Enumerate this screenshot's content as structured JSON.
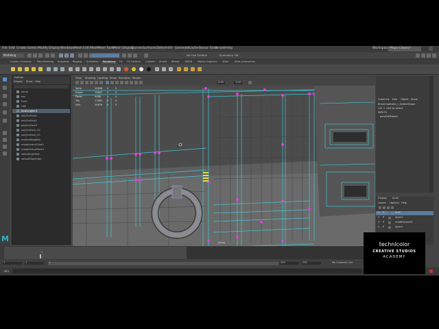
{
  "menubar": {
    "items": [
      "File",
      "Edit",
      "Create",
      "Select",
      "Modify",
      "Display",
      "Windows",
      "Mesh",
      "Edit Mesh",
      "Mesh Tools",
      "Mesh Display",
      "Curves",
      "Surfaces",
      "Deform",
      "UV",
      "Generate",
      "Cache",
      "Bonus Tools",
      "Arnold",
      "Help"
    ],
    "workspace_label": "Workspace:",
    "workspace_value": "Maya Classic*"
  },
  "statusline": {
    "mode_value": "Modeling",
    "no_live_surface": "No Live Surface",
    "symmetry": "Symmetry: Off"
  },
  "shelf": {
    "tabs": [
      "Curves / Surfaces",
      "Poly Modeling",
      "Sculpting",
      "Rigging",
      "Animation",
      "Rendering",
      "FX",
      "FX Caching",
      "Custom",
      "Arnold",
      "Bifrost",
      "MASH",
      "Motion Graphics",
      "XGen",
      "XGen_Interactive"
    ]
  },
  "outliner": {
    "title": "Outliner",
    "menu": [
      "Display",
      "Show",
      "Help"
    ],
    "items": [
      {
        "label": "persp",
        "selected": false
      },
      {
        "label": "top",
        "selected": false
      },
      {
        "label": "front",
        "selected": false
      },
      {
        "label": "side",
        "selected": false
      },
      {
        "label": "Bowlonglam1",
        "selected": true
      },
      {
        "label": "polySurface1",
        "selected": false
      },
      {
        "label": "polySurface2",
        "selected": false
      },
      {
        "label": "polySurface3",
        "selected": false
      },
      {
        "label": "polySurface_CG",
        "selected": false
      },
      {
        "label": "polySurface_CO",
        "selected": false
      },
      {
        "label": "ecoBuildingWall",
        "selected": false
      },
      {
        "label": "ecosphere:pCube1",
        "selected": false
      },
      {
        "label": "ecosphere:pPlane1",
        "selected": false
      },
      {
        "label": "defaultLightSet",
        "selected": false
      },
      {
        "label": "defaultObjectSet",
        "selected": false
      }
    ]
  },
  "viewport": {
    "menu": [
      "View",
      "Shading",
      "Lighting",
      "Show",
      "Renderer",
      "Panels"
    ],
    "hud_rows": [
      {
        "label": "Verts",
        "a": "10898",
        "b": "0",
        "c": "0"
      },
      {
        "label": "Edges",
        "a": "19847",
        "b": "0",
        "c": "0"
      },
      {
        "label": "Faces",
        "a": "9088",
        "b": "0",
        "c": "0"
      },
      {
        "label": "Tris",
        "a": "17892",
        "b": "0",
        "c": "0"
      },
      {
        "label": "UVs",
        "a": "10879",
        "b": "0",
        "c": "0"
      }
    ],
    "field_a": "0.00",
    "field_b": "1.00",
    "camera_label": "persp"
  },
  "channelbox": {
    "menu": [
      "Channels",
      "Edit",
      "Object",
      "Show"
    ],
    "lines": [
      "BrushCapitalio_c_GoblinShape",
      "Ctrl + click to select",
      "INPUTS",
      "polySoftEdge1"
    ]
  },
  "layers": {
    "tabs": [
      "Display",
      "Anim"
    ],
    "menu": [
      "Layers",
      "Options",
      "Help"
    ],
    "items": [
      {
        "label": "bust",
        "selected": true
      },
      {
        "label": "layer2",
        "selected": false
      },
      {
        "label": "modelsLayer2",
        "selected": false
      },
      {
        "label": "layer1",
        "selected": false
      }
    ]
  },
  "timeslider": {
    "start": "1",
    "end": "1",
    "range_start": "1",
    "range_inner": "1",
    "current": "1",
    "range_end": "200",
    "end_max": "200",
    "character_set": "No Character Set"
  },
  "cmdline": {
    "label": "MEL"
  },
  "brand": {
    "line1": "technicolor",
    "line2": "CREATIVE STUDIOS",
    "line3": "ACADEMY"
  },
  "colors": {
    "selection": "#e040e0",
    "wire": "#3fd6e6",
    "background": "#444444"
  }
}
